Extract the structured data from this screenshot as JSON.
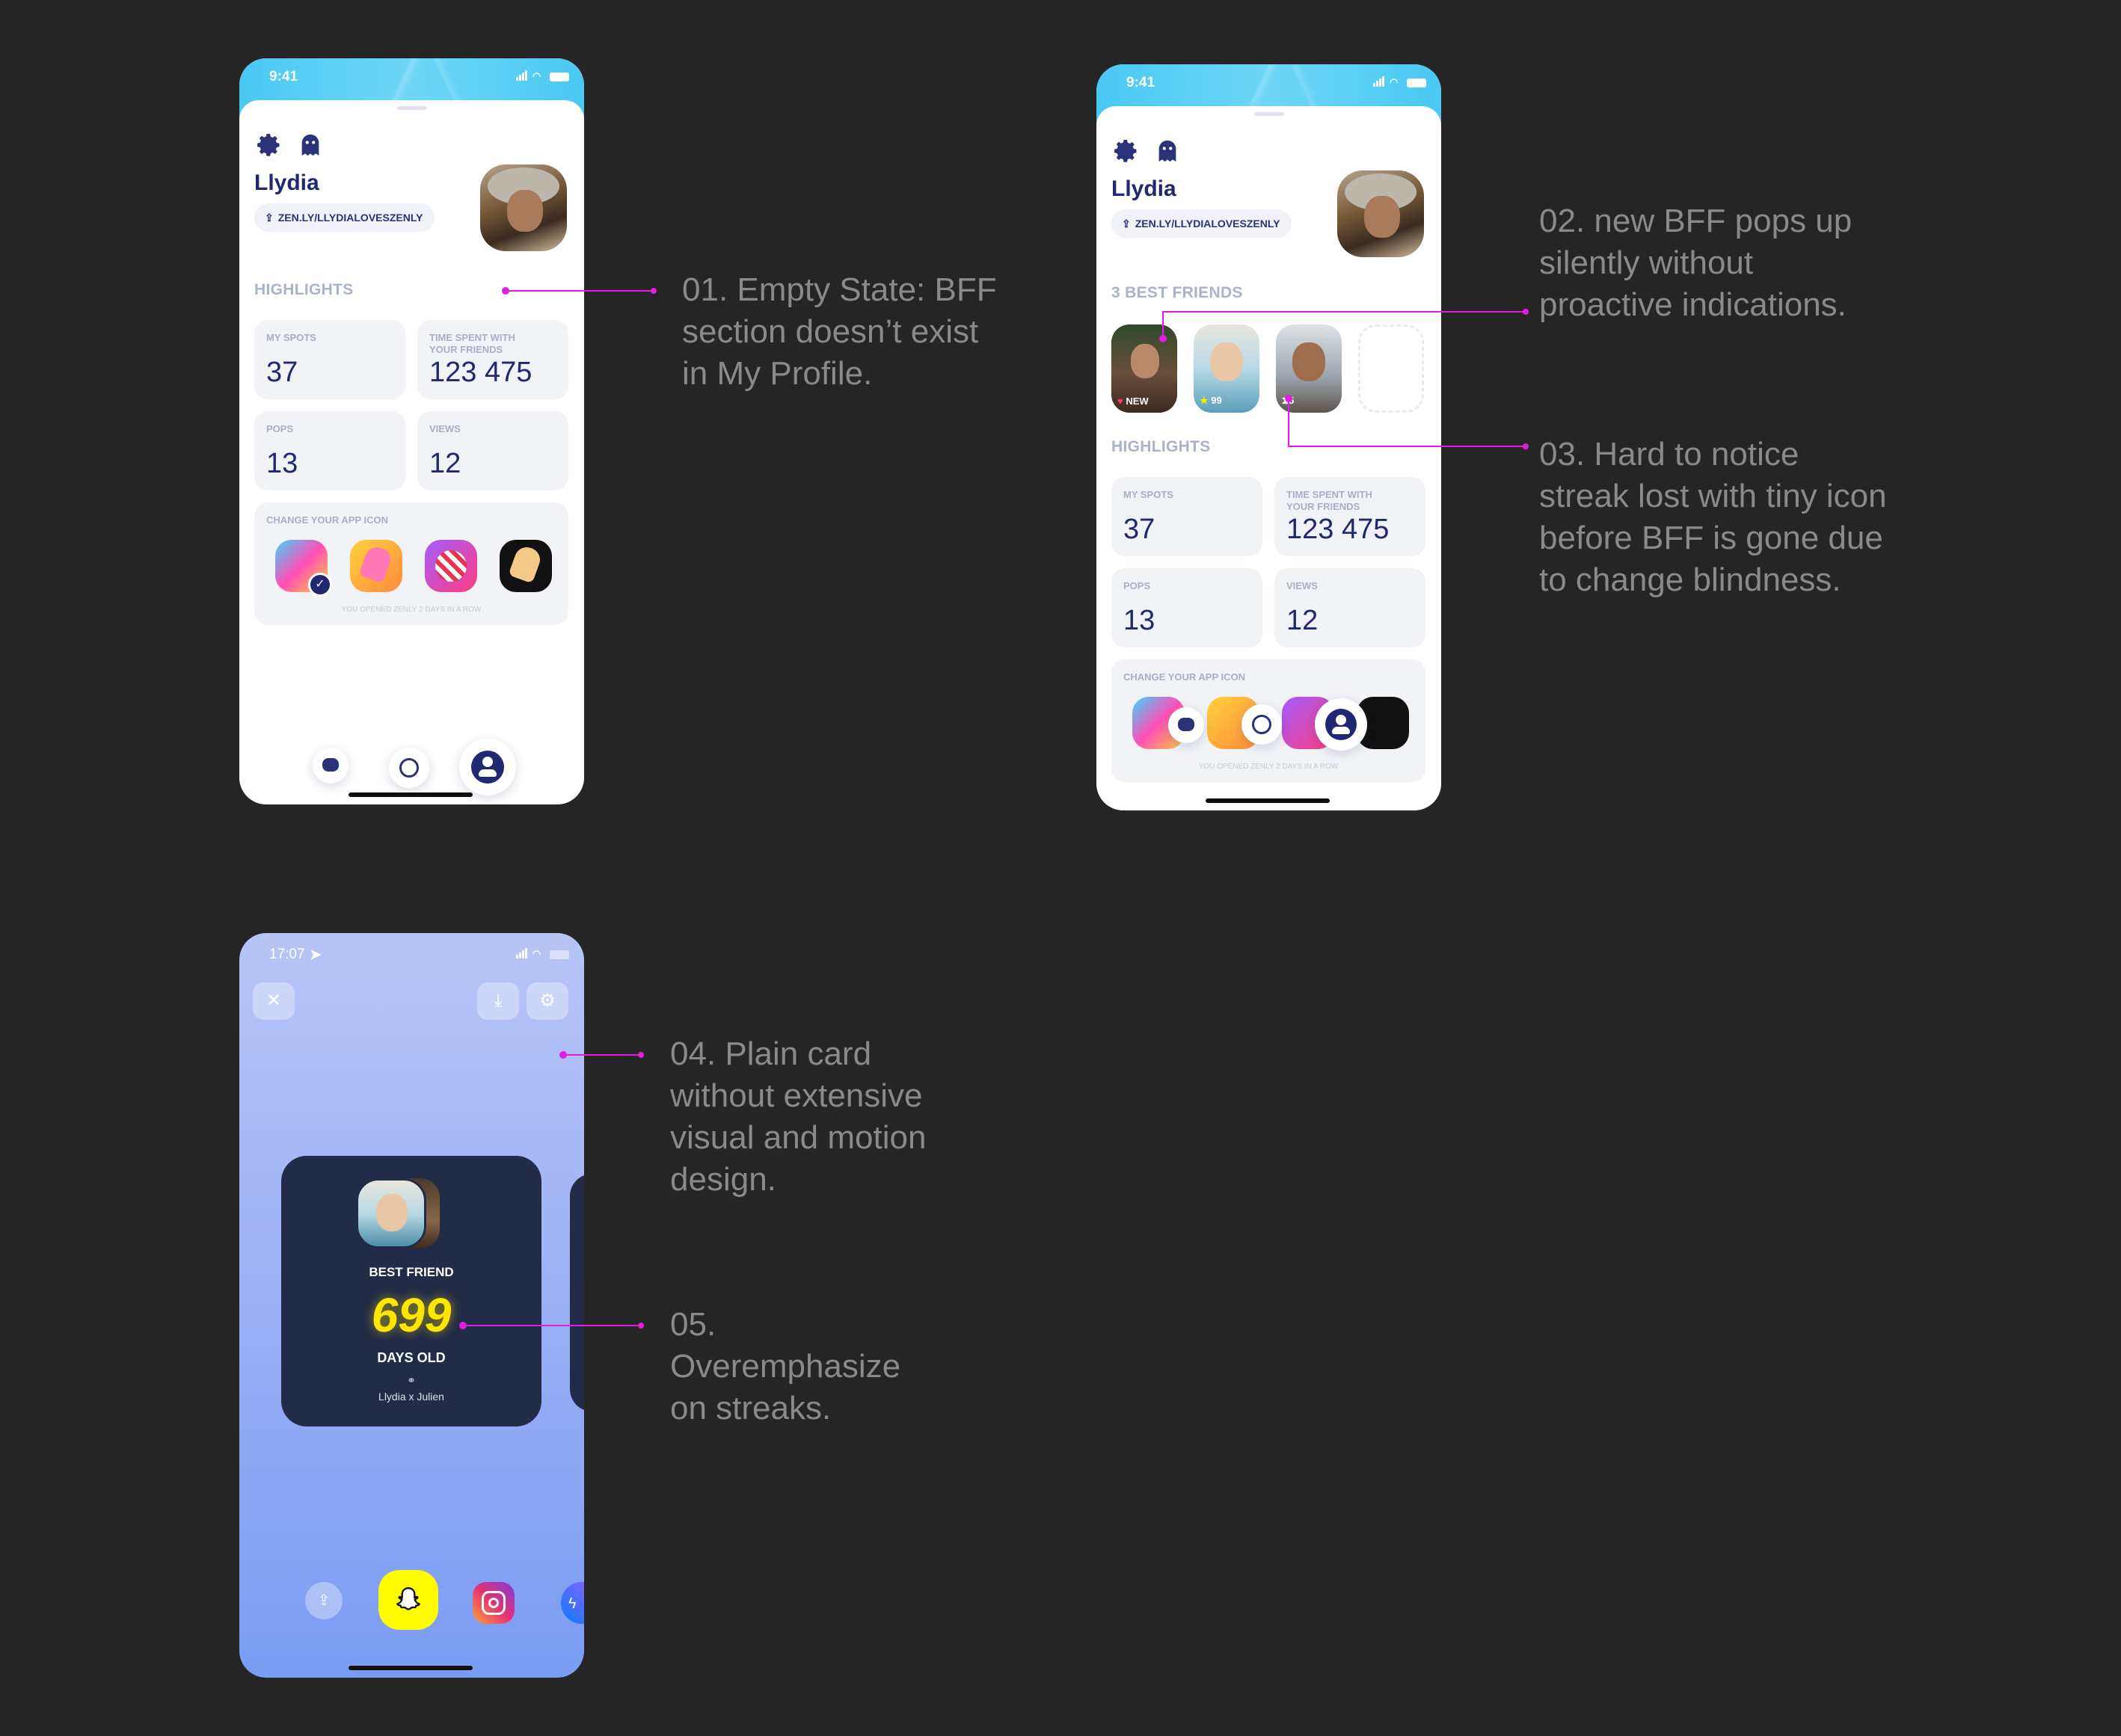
{
  "screen1": {
    "status_time": "9:41",
    "user_name": "Llydia",
    "profile_link": "ZEN.LY/LLYDIALOVESZENLY",
    "highlights_title": "HIGHLIGHTS",
    "stats": [
      {
        "label": "MY SPOTS",
        "value": "37"
      },
      {
        "label": "TIME SPENT WITH YOUR FRIENDS",
        "value": "123 475"
      },
      {
        "label": "POPS",
        "value": "13"
      },
      {
        "label": "VIEWS",
        "value": "12"
      }
    ],
    "app_icon_title": "CHANGE YOUR APP ICON",
    "streak_text": "YOU OPENED ZENLY 2 DAYS IN A ROW"
  },
  "screen2": {
    "status_time": "9:41",
    "user_name": "Llydia",
    "profile_link": "ZEN.LY/LLYDIALOVESZENLY",
    "bff_title": "3 BEST FRIENDS",
    "bff_badges": [
      "NEW",
      "99",
      "5"
    ],
    "highlights_title": "HIGHLIGHTS",
    "stats": [
      {
        "label": "MY SPOTS",
        "value": "37"
      },
      {
        "label": "TIME SPENT WITH YOUR FRIENDS",
        "value": "123 475"
      },
      {
        "label": "POPS",
        "value": "13"
      },
      {
        "label": "VIEWS",
        "value": "12"
      }
    ],
    "app_icon_title": "CHANGE YOUR APP ICON",
    "streak_text": "YOU OPENED ZENLY 2 DAYS IN A ROW"
  },
  "screen3": {
    "status_time": "17:07",
    "card_label": "BEST FRIEND",
    "days_number": "699",
    "days_label": "DAYS OLD",
    "pair_names": "Llydia x Julien"
  },
  "notes": {
    "n1": "01. Empty State: BFF\nsection doesn’t exist\nin My Profile.",
    "n2": "02. new BFF pops up\nsilently without\nproactive indications.",
    "n3": "03. Hard to notice\nstreak lost with tiny icon\nbefore BFF is gone due\nto change blindness.",
    "n4": "04. Plain card\nwithout extensive\nvisual and motion\ndesign.",
    "n5": "05.\nOveremphasize\non streaks."
  },
  "colors": {
    "background": "#252525",
    "accent_pink": "#e21ce0",
    "navy": "#1f2870",
    "streak_yellow": "#ffe600"
  }
}
